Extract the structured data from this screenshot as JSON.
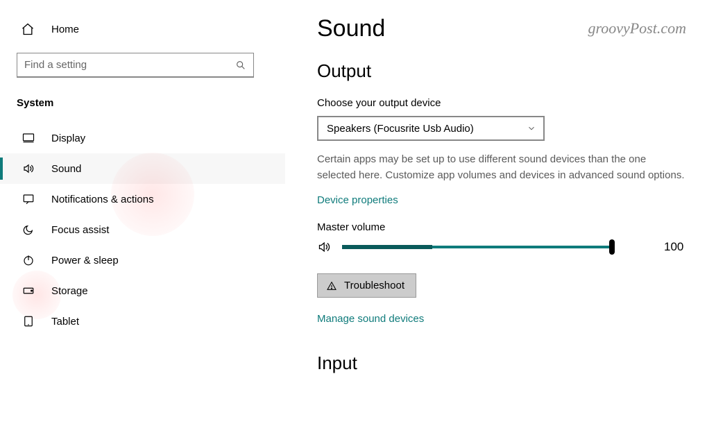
{
  "watermark": "groovyPost.com",
  "sidebar": {
    "home_label": "Home",
    "search_placeholder": "Find a setting",
    "category": "System",
    "items": [
      {
        "label": "Display"
      },
      {
        "label": "Sound"
      },
      {
        "label": "Notifications & actions"
      },
      {
        "label": "Focus assist"
      },
      {
        "label": "Power & sleep"
      },
      {
        "label": "Storage"
      },
      {
        "label": "Tablet"
      }
    ]
  },
  "main": {
    "title": "Sound",
    "output": {
      "heading": "Output",
      "choose_label": "Choose your output device",
      "device_selected": "Speakers (Focusrite Usb Audio)",
      "help_text": "Certain apps may be set up to use different sound devices than the one selected here. Customize app volumes and devices in advanced sound options.",
      "device_properties": "Device properties",
      "master_volume_label": "Master volume",
      "master_volume_value": "100",
      "troubleshoot": "Troubleshoot",
      "manage_devices": "Manage sound devices"
    },
    "input": {
      "heading": "Input"
    }
  }
}
